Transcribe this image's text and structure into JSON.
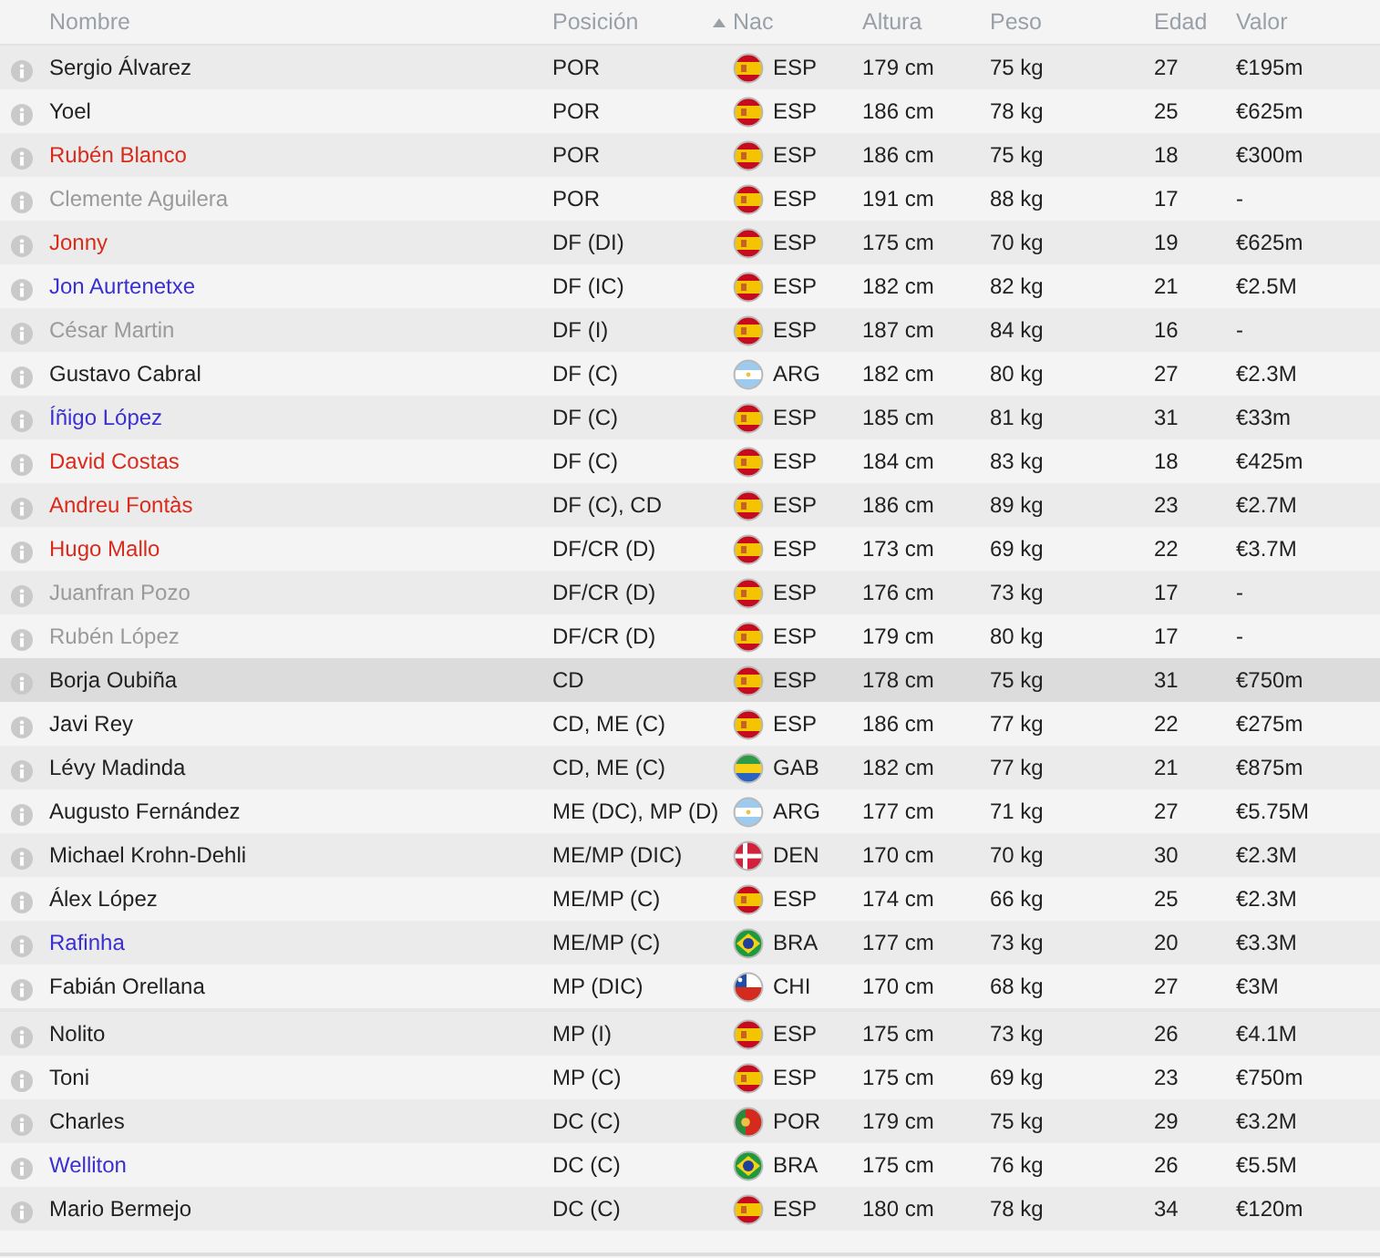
{
  "columns": [
    {
      "label": "Nombre",
      "sorted": false
    },
    {
      "label": "Posición",
      "sorted": false
    },
    {
      "label": "Nac",
      "sorted": true
    },
    {
      "label": "Altura",
      "sorted": false
    },
    {
      "label": "Peso",
      "sorted": false
    },
    {
      "label": "Edad",
      "sorted": false
    },
    {
      "label": "Valor",
      "sorted": false
    }
  ],
  "groups": [
    {
      "rows": [
        {
          "name": "Sergio Álvarez",
          "color": "#222222",
          "selected": false,
          "position": "POR",
          "kind": "spain",
          "nation": "ESP",
          "height": "179 cm",
          "weight": "75 kg",
          "age": "27",
          "value": "€195m"
        },
        {
          "name": "Yoel",
          "color": "#222222",
          "selected": false,
          "position": "POR",
          "kind": "spain",
          "nation": "ESP",
          "height": "186 cm",
          "weight": "78 kg",
          "age": "25",
          "value": "€625m"
        },
        {
          "name": "Rubén Blanco",
          "color": "#d92b1c",
          "selected": false,
          "position": "POR",
          "kind": "spain",
          "nation": "ESP",
          "height": "186 cm",
          "weight": "75 kg",
          "age": "18",
          "value": "€300m"
        },
        {
          "name": "Clemente Aguilera",
          "color": "#9a9a9a",
          "selected": false,
          "position": "POR",
          "kind": "spain",
          "nation": "ESP",
          "height": "191 cm",
          "weight": "88 kg",
          "age": "17",
          "value": "-"
        },
        {
          "name": "Jonny",
          "color": "#d92b1c",
          "selected": false,
          "position": "DF (DI)",
          "kind": "spain",
          "nation": "ESP",
          "height": "175 cm",
          "weight": "70 kg",
          "age": "19",
          "value": "€625m"
        },
        {
          "name": "Jon Aurtenetxe",
          "color": "#3a2fd0",
          "selected": false,
          "position": "DF (IC)",
          "kind": "spain",
          "nation": "ESP",
          "height": "182 cm",
          "weight": "82 kg",
          "age": "21",
          "value": "€2.5M"
        },
        {
          "name": "César Martin",
          "color": "#9a9a9a",
          "selected": false,
          "position": "DF (I)",
          "kind": "spain",
          "nation": "ESP",
          "height": "187 cm",
          "weight": "84 kg",
          "age": "16",
          "value": "-"
        },
        {
          "name": "Gustavo Cabral",
          "color": "#222222",
          "selected": false,
          "position": "DF (C)",
          "kind": "argentina",
          "nation": "ARG",
          "height": "182 cm",
          "weight": "80 kg",
          "age": "27",
          "value": "€2.3M"
        },
        {
          "name": "Íñigo López",
          "color": "#3a2fd0",
          "selected": false,
          "position": "DF (C)",
          "kind": "spain",
          "nation": "ESP",
          "height": "185 cm",
          "weight": "81 kg",
          "age": "31",
          "value": "€33m"
        },
        {
          "name": "David Costas",
          "color": "#d92b1c",
          "selected": false,
          "position": "DF (C)",
          "kind": "spain",
          "nation": "ESP",
          "height": "184 cm",
          "weight": "83 kg",
          "age": "18",
          "value": "€425m"
        },
        {
          "name": "Andreu Fontàs",
          "color": "#d92b1c",
          "selected": false,
          "position": "DF (C), CD",
          "kind": "spain",
          "nation": "ESP",
          "height": "186 cm",
          "weight": "89 kg",
          "age": "23",
          "value": "€2.7M"
        },
        {
          "name": "Hugo Mallo",
          "color": "#d92b1c",
          "selected": false,
          "position": "DF/CR (D)",
          "kind": "spain",
          "nation": "ESP",
          "height": "173 cm",
          "weight": "69 kg",
          "age": "22",
          "value": "€3.7M"
        },
        {
          "name": "Juanfran Pozo",
          "color": "#9a9a9a",
          "selected": false,
          "position": "DF/CR (D)",
          "kind": "spain",
          "nation": "ESP",
          "height": "176 cm",
          "weight": "73 kg",
          "age": "17",
          "value": "-"
        },
        {
          "name": "Rubén López",
          "color": "#9a9a9a",
          "selected": false,
          "position": "DF/CR (D)",
          "kind": "spain",
          "nation": "ESP",
          "height": "179 cm",
          "weight": "80 kg",
          "age": "17",
          "value": "-"
        },
        {
          "name": "Borja Oubiña",
          "color": "#222222",
          "selected": true,
          "position": "CD",
          "kind": "spain",
          "nation": "ESP",
          "height": "178 cm",
          "weight": "75 kg",
          "age": "31",
          "value": "€750m"
        },
        {
          "name": "Javi Rey",
          "color": "#222222",
          "selected": false,
          "position": "CD, ME (C)",
          "kind": "spain",
          "nation": "ESP",
          "height": "186 cm",
          "weight": "77 kg",
          "age": "22",
          "value": "€275m"
        },
        {
          "name": "Lévy Madinda",
          "color": "#222222",
          "selected": false,
          "position": "CD, ME (C)",
          "kind": "gabon",
          "nation": "GAB",
          "height": "182 cm",
          "weight": "77 kg",
          "age": "21",
          "value": "€875m"
        },
        {
          "name": "Augusto Fernández",
          "color": "#222222",
          "selected": false,
          "position": "ME (DC), MP (D)",
          "kind": "argentina",
          "nation": "ARG",
          "height": "177 cm",
          "weight": "71 kg",
          "age": "27",
          "value": "€5.75M"
        },
        {
          "name": "Michael Krohn-Dehli",
          "color": "#222222",
          "selected": false,
          "position": "ME/MP (DIC)",
          "kind": "denmark",
          "nation": "DEN",
          "height": "170 cm",
          "weight": "70 kg",
          "age": "30",
          "value": "€2.3M"
        },
        {
          "name": "Álex López",
          "color": "#222222",
          "selected": false,
          "position": "ME/MP (C)",
          "kind": "spain",
          "nation": "ESP",
          "height": "174 cm",
          "weight": "66 kg",
          "age": "25",
          "value": "€2.3M"
        },
        {
          "name": "Rafinha",
          "color": "#3a2fd0",
          "selected": false,
          "position": "ME/MP (C)",
          "kind": "brazil",
          "nation": "BRA",
          "height": "177 cm",
          "weight": "73 kg",
          "age": "20",
          "value": "€3.3M"
        },
        {
          "name": "Fabián Orellana",
          "color": "#222222",
          "selected": false,
          "position": "MP (DIC)",
          "kind": "chile",
          "nation": "CHI",
          "height": "170 cm",
          "weight": "68 kg",
          "age": "27",
          "value": "€3M"
        }
      ]
    },
    {
      "rows": [
        {
          "name": "Nolito",
          "color": "#222222",
          "selected": false,
          "position": "MP (I)",
          "kind": "spain",
          "nation": "ESP",
          "height": "175 cm",
          "weight": "73 kg",
          "age": "26",
          "value": "€4.1M"
        },
        {
          "name": "Toni",
          "color": "#222222",
          "selected": false,
          "position": "MP (C)",
          "kind": "spain",
          "nation": "ESP",
          "height": "175 cm",
          "weight": "69 kg",
          "age": "23",
          "value": "€750m"
        },
        {
          "name": "Charles",
          "color": "#222222",
          "selected": false,
          "position": "DC (C)",
          "kind": "portugal",
          "nation": "POR",
          "height": "179 cm",
          "weight": "75 kg",
          "age": "29",
          "value": "€3.2M"
        },
        {
          "name": "Welliton",
          "color": "#3a2fd0",
          "selected": false,
          "position": "DC (C)",
          "kind": "brazil",
          "nation": "BRA",
          "height": "175 cm",
          "weight": "76 kg",
          "age": "26",
          "value": "€5.5M"
        },
        {
          "name": "Mario Bermejo",
          "color": "#222222",
          "selected": false,
          "position": "DC (C)",
          "kind": "spain",
          "nation": "ESP",
          "height": "180 cm",
          "weight": "78 kg",
          "age": "34",
          "value": "€120m"
        }
      ]
    }
  ]
}
